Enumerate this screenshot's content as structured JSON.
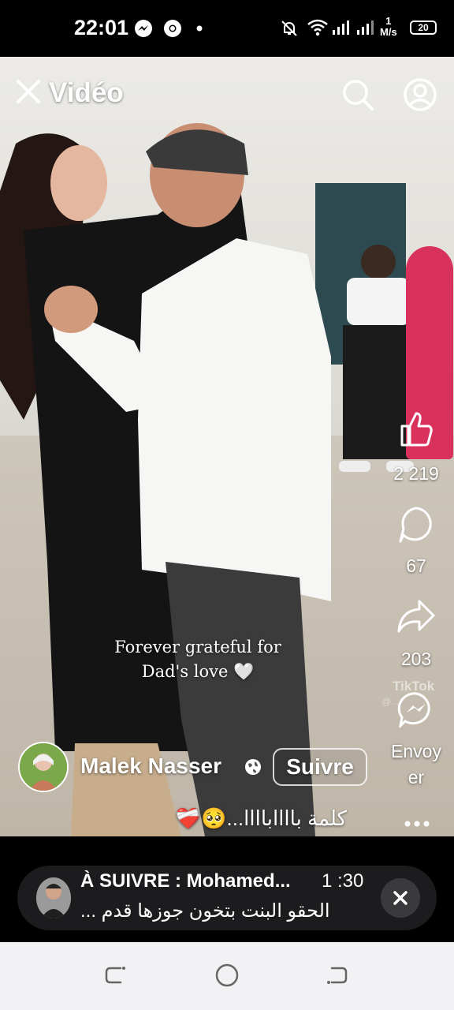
{
  "status_bar": {
    "time": "22:01",
    "speed_value": "1",
    "speed_unit": "M/s",
    "battery": "20"
  },
  "header": {
    "title": "Vidéo"
  },
  "actions": {
    "likes": "2 219",
    "comments": "67",
    "shares": "203",
    "send_label_1": "Envoy",
    "send_label_2": "er"
  },
  "video": {
    "caption_line1": "Forever grateful for",
    "caption_line2": "Dad's love 🤍",
    "watermark": "TikTok",
    "watermark_handle": "@...",
    "colors": {
      "door": "#2c4a50",
      "shirt": "#ffffff",
      "dress": "#141414"
    }
  },
  "post": {
    "author": "Malek Nasser",
    "follow_label": "Suivre",
    "text": "كلمة بااااباااا...🥺❤️‍🩹"
  },
  "next_up": {
    "title": "À SUIVRE : Mohamed...",
    "duration": "1 :30",
    "subtitle": "الحقو البنت بتخون جوزها قدم ..."
  }
}
